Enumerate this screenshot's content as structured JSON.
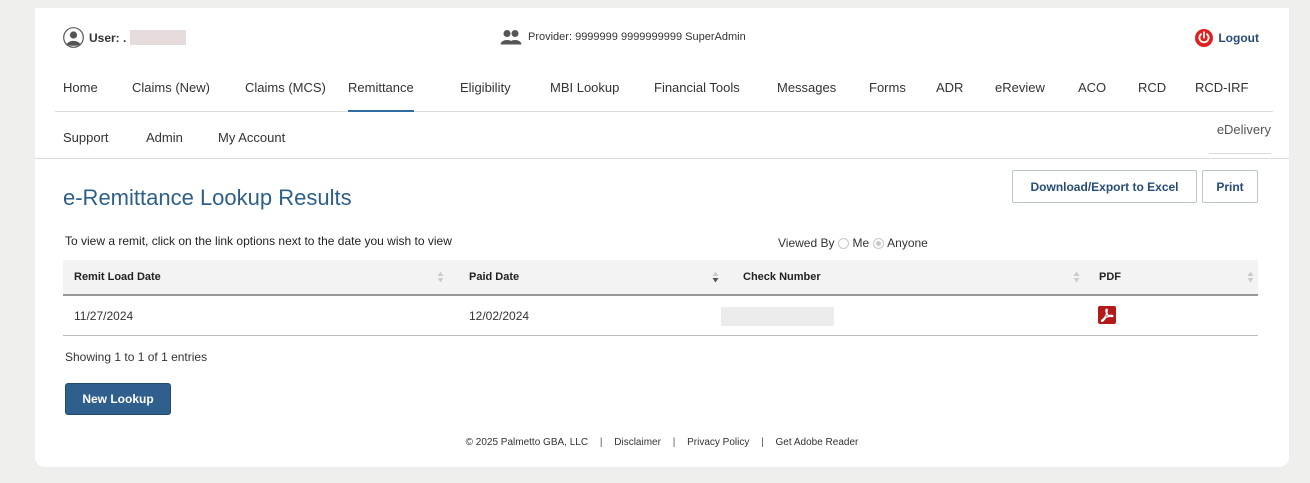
{
  "header": {
    "user_label": "User: .",
    "provider_text": "Provider: 9999999  9999999999 SuperAdmin",
    "logout_label": "Logout",
    "logout_color": "#e02020"
  },
  "nav": {
    "row1": [
      {
        "label": "Home",
        "active": false
      },
      {
        "label": "Claims (New)",
        "active": false
      },
      {
        "label": "Claims (MCS)",
        "active": false
      },
      {
        "label": "Remittance",
        "active": true
      },
      {
        "label": "Eligibility",
        "active": false
      },
      {
        "label": "MBI Lookup",
        "active": false
      },
      {
        "label": "Financial Tools",
        "active": false
      },
      {
        "label": "Messages",
        "active": false
      },
      {
        "label": "Forms",
        "active": false
      },
      {
        "label": "ADR",
        "active": false
      },
      {
        "label": "eReview",
        "active": false
      },
      {
        "label": "ACO",
        "active": false
      },
      {
        "label": "RCD",
        "active": false
      },
      {
        "label": "RCD-IRF",
        "active": false
      }
    ],
    "row2": [
      {
        "label": "Support"
      },
      {
        "label": "Admin"
      },
      {
        "label": "My Account"
      }
    ],
    "edelivery": "eDelivery"
  },
  "main": {
    "title": "e-Remittance Lookup Results",
    "export_label": "Download/Export to Excel",
    "print_label": "Print",
    "instruction": "To view a remit, click on the link options next to the date you wish to view",
    "viewed_by_label": "Viewed By",
    "viewed_by_options": [
      {
        "label": "Me",
        "checked": false
      },
      {
        "label": "Anyone",
        "checked": true
      }
    ]
  },
  "table": {
    "columns": [
      "Remit Load Date",
      "Paid Date",
      "Check Number",
      "PDF"
    ],
    "rows": [
      {
        "remit_load_date": "11/27/2024",
        "paid_date": "12/02/2024",
        "check_number": "",
        "pdf_icon": "pdf-icon"
      }
    ],
    "showing": "Showing 1 to 1 of 1 entries"
  },
  "new_lookup_label": "New Lookup",
  "footer": {
    "copyright": "© 2025 Palmetto GBA, LLC",
    "links": [
      "Disclaimer",
      "Privacy Policy",
      "Get Adobe Reader"
    ]
  },
  "colors": {
    "accent": "#2c5f8a",
    "primary_button": "#2f5f8c",
    "pdf_red": "#b31b1b"
  }
}
